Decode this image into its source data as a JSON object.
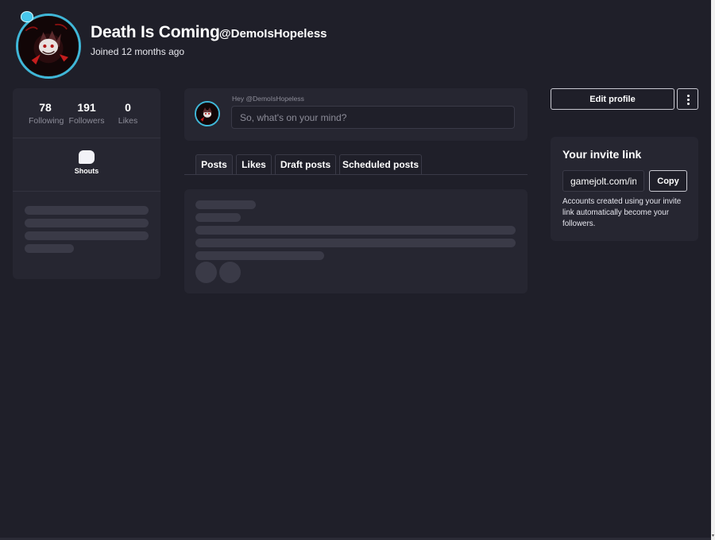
{
  "header": {
    "name": "Death Is Coming",
    "handle": "@DemoIsHopeless",
    "joined": "Joined 12 months ago"
  },
  "stats": [
    {
      "value": "78",
      "label": "Following"
    },
    {
      "value": "191",
      "label": "Followers"
    },
    {
      "value": "0",
      "label": "Likes"
    }
  ],
  "shouts": {
    "label": "Shouts",
    "icon": "speech-bubble-icon"
  },
  "composer": {
    "greeting": "Hey @DemoIsHopeless",
    "placeholder": "So, what's on your mind?"
  },
  "tabs": [
    {
      "label": "Posts",
      "active": true
    },
    {
      "label": "Likes",
      "active": false
    },
    {
      "label": "Draft posts",
      "active": false
    },
    {
      "label": "Scheduled posts",
      "active": false
    }
  ],
  "actions": {
    "edit_profile": "Edit profile",
    "more_icon": "vertical-dots-icon"
  },
  "invite": {
    "title": "Your invite link",
    "link_value": "gamejolt.com/invite/DemoIsHopeless",
    "copy_label": "Copy",
    "description": "Accounts created using your invite link automatically become your followers."
  },
  "colors": {
    "background": "#1f1f29",
    "card": "#262631",
    "skeleton": "#3a3a47",
    "avatar_ring": "#3fb7d8"
  }
}
